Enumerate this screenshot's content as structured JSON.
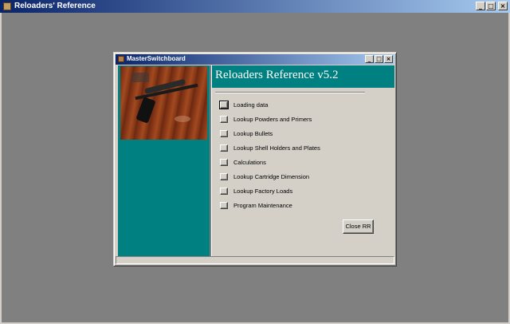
{
  "outer_window": {
    "title": "Reloaders' Reference",
    "buttons": {
      "minimize": "_",
      "maximize": "□",
      "close": "×"
    }
  },
  "dialog": {
    "title": "MasterSwitchboard",
    "buttons": {
      "minimize": "_",
      "maximize": "□",
      "close": "×"
    },
    "app_title": "Reloaders Reference v5.2",
    "menu_items": [
      {
        "label": "Loading data"
      },
      {
        "label": "Lookup Powders and Primers"
      },
      {
        "label": "Lookup Bullets"
      },
      {
        "label": "Lookup Shell Holders and Plates"
      },
      {
        "label": "Calculations"
      },
      {
        "label": "Lookup Cartridge Dimension"
      },
      {
        "label": "Lookup Factory Loads"
      },
      {
        "label": "Program Maintenance"
      }
    ],
    "close_button": "Close RR"
  },
  "colors": {
    "teal": "#008080",
    "face": "#d4d0c8",
    "desktop": "#808080",
    "title_active": "#0a246a"
  }
}
